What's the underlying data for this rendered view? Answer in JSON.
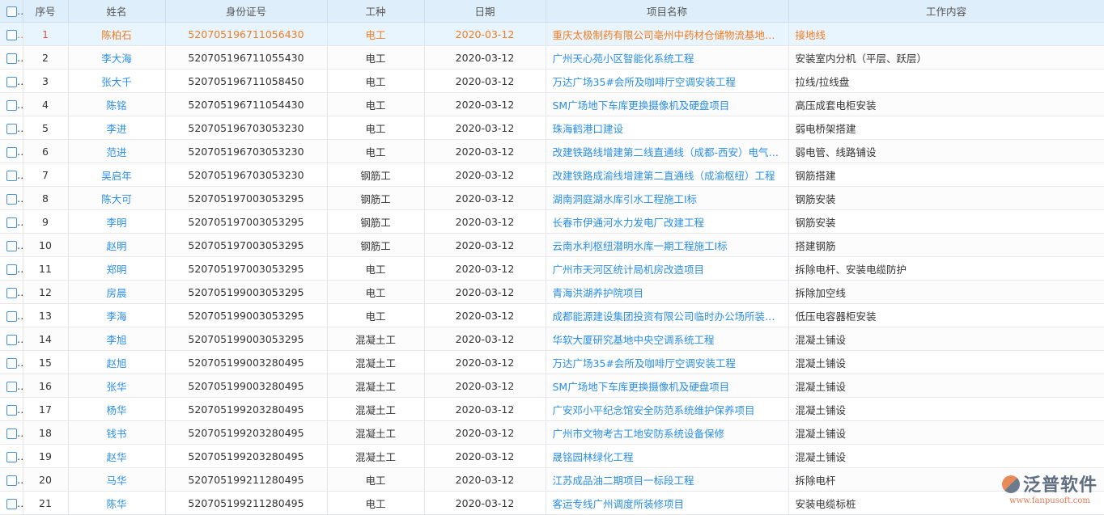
{
  "headers": [
    "序号",
    "姓名",
    "身份证号",
    "工种",
    "日期",
    "项目名称",
    "工作内容"
  ],
  "rows": [
    {
      "no": "1",
      "name": "陈柏石",
      "id": "520705196711056430",
      "trade": "电工",
      "date": "2020-03-12",
      "project": "重庆太极制药有限公司亳州中药材仓储物流基地项目",
      "work": "接地线",
      "selected": true
    },
    {
      "no": "2",
      "name": "李大海",
      "id": "520705196711055430",
      "trade": "电工",
      "date": "2020-03-12",
      "project": "广州天心苑小区智能化系统工程",
      "work": "安装室内分机（平层、跃层）"
    },
    {
      "no": "3",
      "name": "张大千",
      "id": "520705196711058450",
      "trade": "电工",
      "date": "2020-03-12",
      "project": "万达广场35#会所及咖啡厅空调安装工程",
      "work": "拉线/拉线盘"
    },
    {
      "no": "4",
      "name": "陈铭",
      "id": "520705196711054430",
      "trade": "电工",
      "date": "2020-03-12",
      "project": "SM广场地下车库更换摄像机及硬盘项目",
      "work": "高压成套电柜安装"
    },
    {
      "no": "5",
      "name": "李进",
      "id": "520705196703053230",
      "trade": "电工",
      "date": "2020-03-12",
      "project": "珠海鹤港口建设",
      "work": "弱电桥架搭建"
    },
    {
      "no": "6",
      "name": "范进",
      "id": "520705196703053230",
      "trade": "电工",
      "date": "2020-03-12",
      "project": "改建铁路线增建第二线直通线（成都-西安）电气化工程",
      "work": "弱电管、线路铺设"
    },
    {
      "no": "7",
      "name": "吴启年",
      "id": "520705196703053230",
      "trade": "钢筋工",
      "date": "2020-03-12",
      "project": "改建铁路成渝线增建第二直通线（成渝枢纽）工程",
      "work": "钢筋搭建"
    },
    {
      "no": "8",
      "name": "陈大可",
      "id": "520705197003053295",
      "trade": "钢筋工",
      "date": "2020-03-12",
      "project": "湖南洞庭湖水库引水工程施工I标",
      "work": "钢筋安装"
    },
    {
      "no": "9",
      "name": "李明",
      "id": "520705197003053295",
      "trade": "钢筋工",
      "date": "2020-03-12",
      "project": "长春市伊通河水力发电厂改建工程",
      "work": "钢筋安装"
    },
    {
      "no": "10",
      "name": "赵明",
      "id": "520705197003053295",
      "trade": "钢筋工",
      "date": "2020-03-12",
      "project": "云南水利枢纽潜明水库一期工程施工I标",
      "work": "搭建钢筋"
    },
    {
      "no": "11",
      "name": "郑明",
      "id": "520705197003053295",
      "trade": "电工",
      "date": "2020-03-12",
      "project": "广州市天河区统计局机房改造项目",
      "work": "拆除电杆、安装电缆防护"
    },
    {
      "no": "12",
      "name": "房晨",
      "id": "520705199003053295",
      "trade": "电工",
      "date": "2020-03-12",
      "project": "青海洪湖养护院项目",
      "work": "拆除加空线"
    },
    {
      "no": "13",
      "name": "李海",
      "id": "520705199003053295",
      "trade": "电工",
      "date": "2020-03-12",
      "project": "成都能源建设集团投资有限公司临时办公场所装修工程",
      "work": "低压电容器柜安装"
    },
    {
      "no": "14",
      "name": "李旭",
      "id": "520705199003053295",
      "trade": "混凝土工",
      "date": "2020-03-12",
      "project": "华软大厦研究基地中央空调系统工程",
      "work": "混凝土铺设"
    },
    {
      "no": "15",
      "name": "赵旭",
      "id": "520705199003280495",
      "trade": "混凝土工",
      "date": "2020-03-12",
      "project": "万达广场35#会所及咖啡厅空调安装工程",
      "work": "混凝土铺设"
    },
    {
      "no": "16",
      "name": "张华",
      "id": "520705199003280495",
      "trade": "混凝土工",
      "date": "2020-03-12",
      "project": "SM广场地下车库更换摄像机及硬盘项目",
      "work": "混凝土铺设"
    },
    {
      "no": "17",
      "name": "杨华",
      "id": "520705199203280495",
      "trade": "混凝土工",
      "date": "2020-03-12",
      "project": "广安邓小平纪念馆安全防范系统维护保养项目",
      "work": "混凝土铺设"
    },
    {
      "no": "18",
      "name": "钱书",
      "id": "520705199203280495",
      "trade": "混凝土工",
      "date": "2020-03-12",
      "project": "广州市文物考古工地安防系统设备保修",
      "work": "混凝土铺设"
    },
    {
      "no": "19",
      "name": "赵华",
      "id": "520705199203280495",
      "trade": "混凝土工",
      "date": "2020-03-12",
      "project": "晟铭园林绿化工程",
      "work": "混凝土铺设"
    },
    {
      "no": "20",
      "name": "马华",
      "id": "520705199211280495",
      "trade": "电工",
      "date": "2020-03-12",
      "project": "江苏成品油二期项目一标段工程",
      "work": "拆除电杆"
    },
    {
      "no": "21",
      "name": "陈华",
      "id": "520705199211280495",
      "trade": "电工",
      "date": "2020-03-12",
      "project": "客运专线广州调度所装修项目",
      "work": "安装电缆标桩"
    }
  ],
  "watermark": {
    "brand": "泛普软件",
    "url": "www.fanpusoft.com"
  }
}
